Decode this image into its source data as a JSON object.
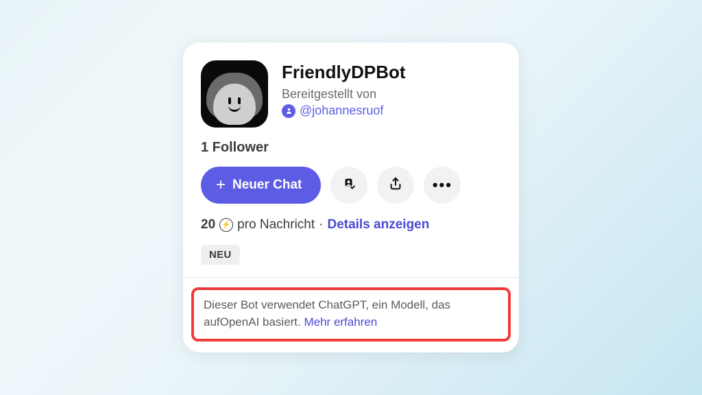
{
  "card": {
    "title": "FriendlyDPBot",
    "provided_by_label": "Bereitgestellt von",
    "author_handle": "@johannesruof",
    "followers_text": "1 Follower",
    "new_chat_label": "Neuer Chat",
    "price_amount": "20",
    "price_unit": "pro Nachricht",
    "separator": "·",
    "details_link": "Details anzeigen",
    "badge": "NEU",
    "disclaimer_a": "Dieser Bot verwendet ChatGPT, ein Modell, das aufOpenAI basiert. ",
    "learn_more": "Mehr erfahren"
  },
  "colors": {
    "accent": "#5d5ce5",
    "highlight_border": "#f03a3a"
  },
  "icons": {
    "avatar": "smiley-avatar",
    "author": "person-circle-icon",
    "add_contact": "person-add-icon",
    "share": "share-icon",
    "more": "more-icon",
    "bolt": "bolt-icon",
    "plus": "plus-icon"
  }
}
